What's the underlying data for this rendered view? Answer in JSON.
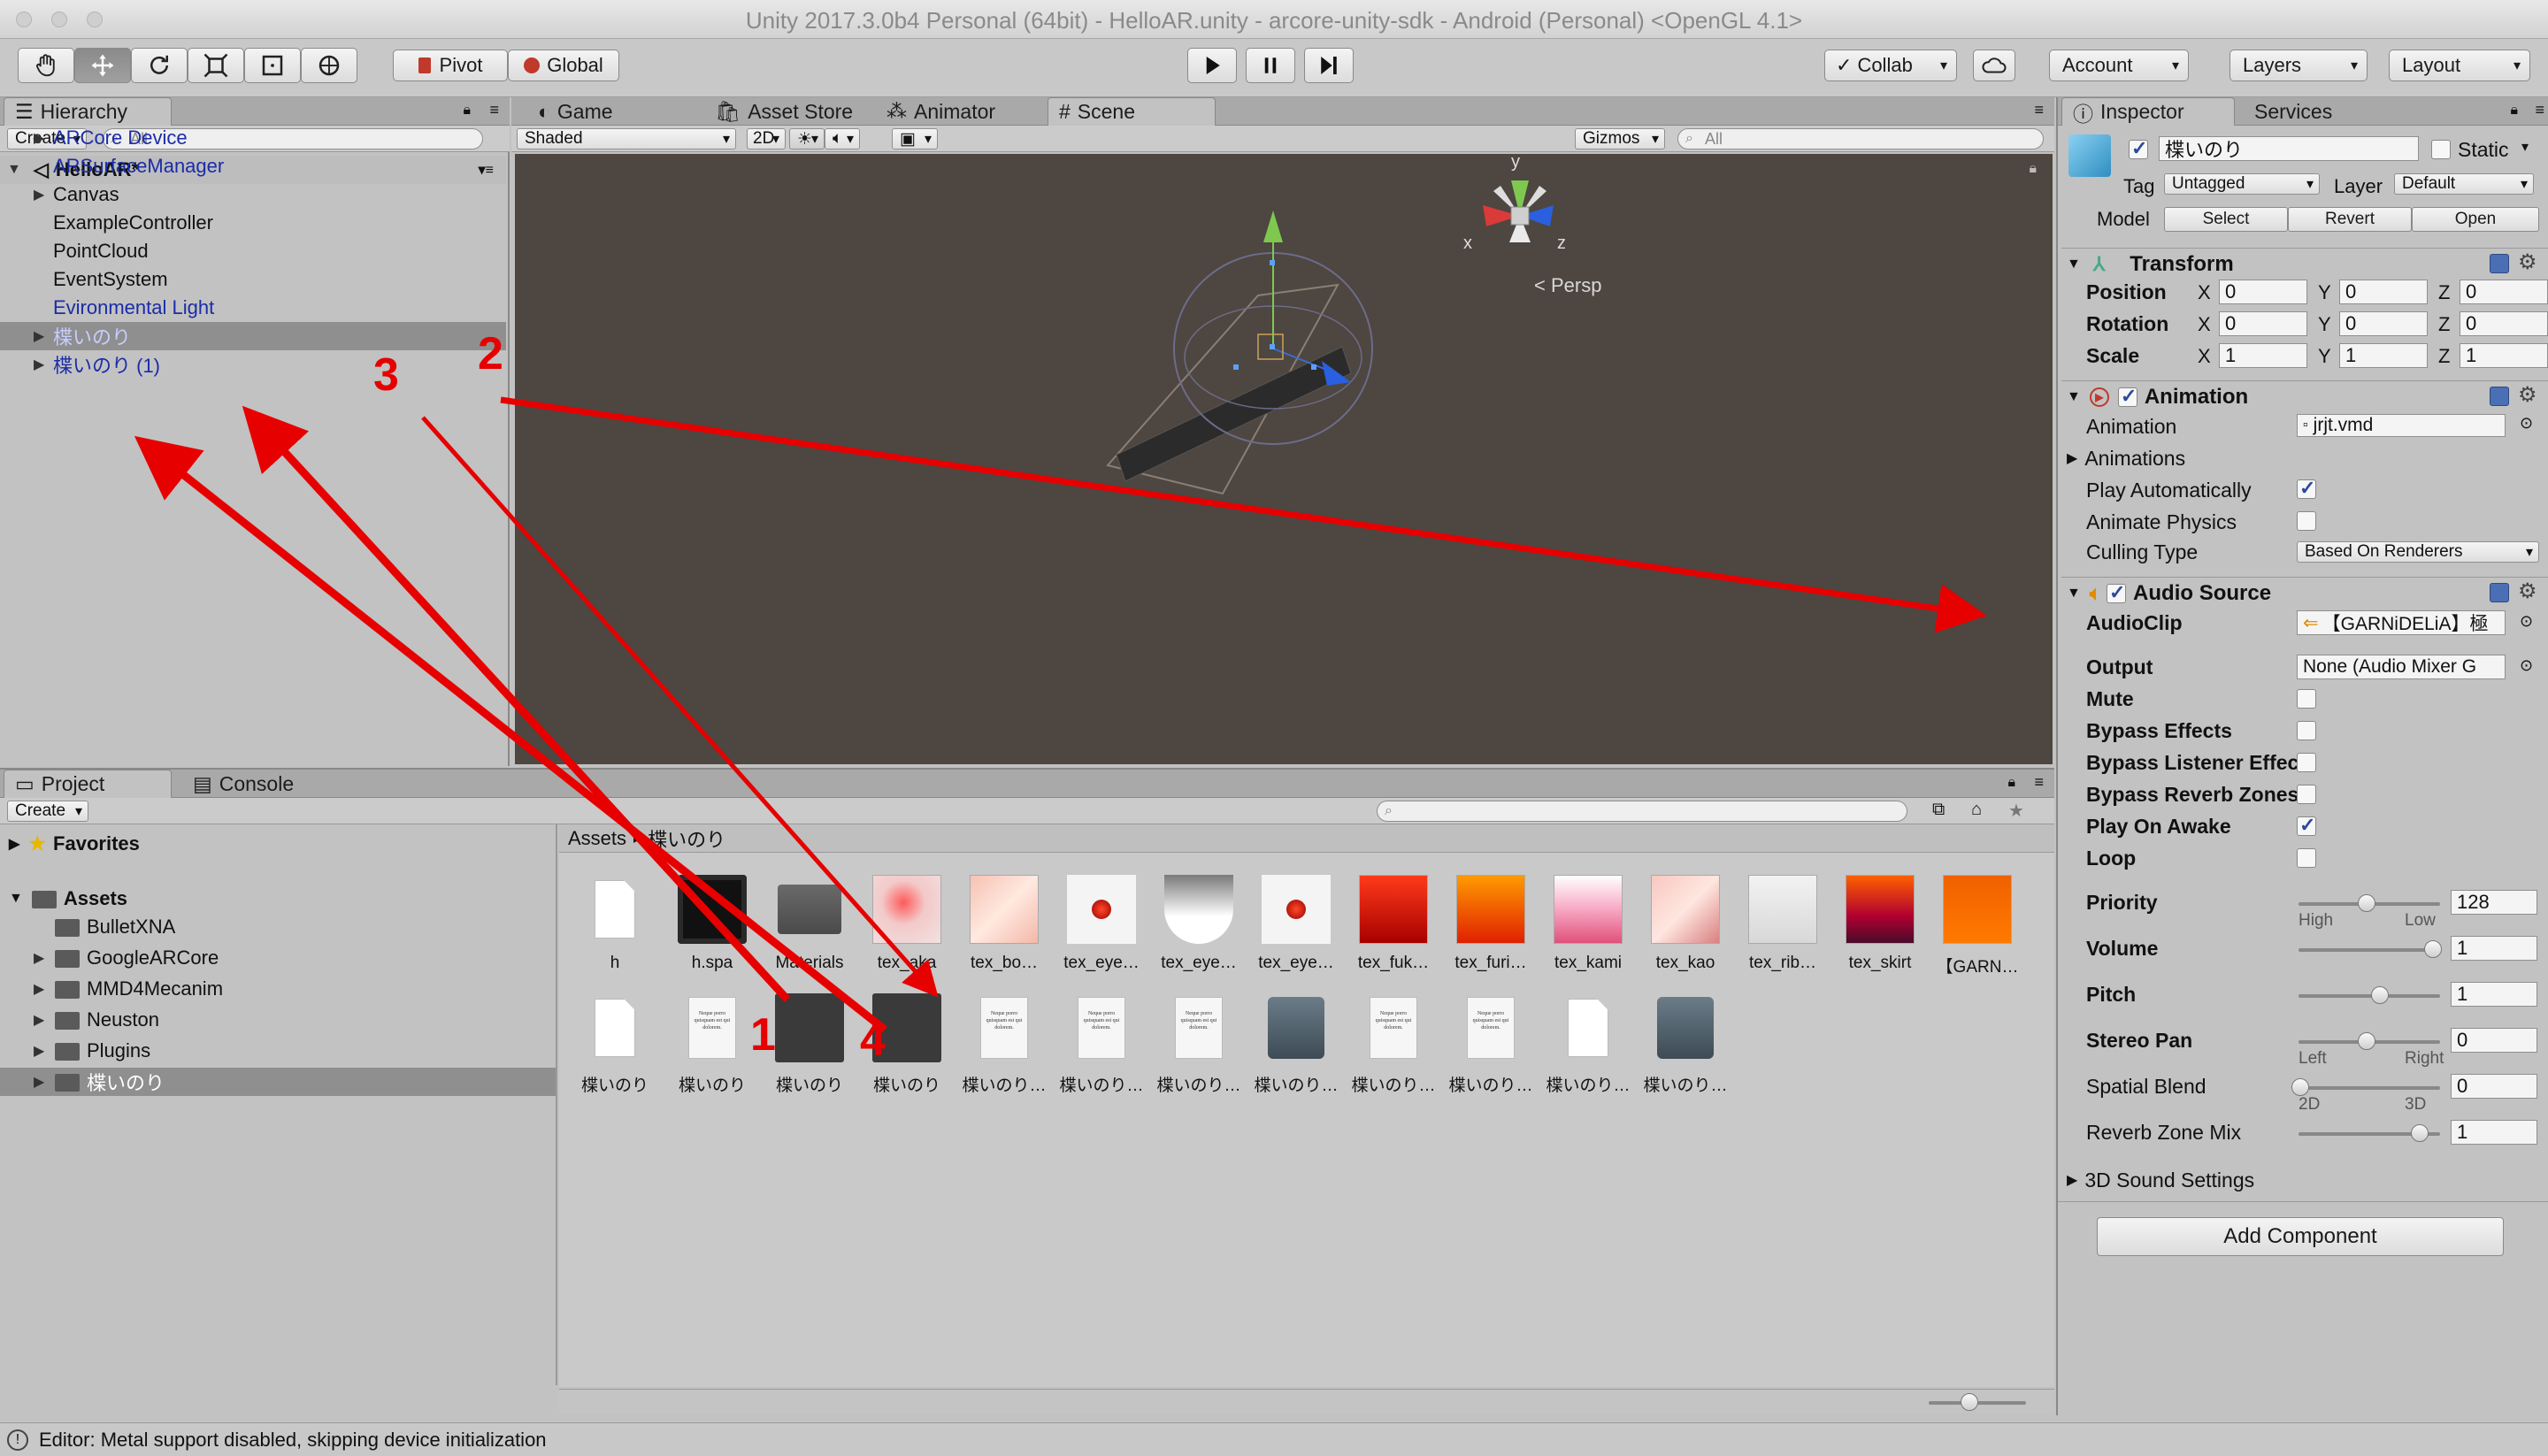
{
  "window": {
    "title": "Unity 2017.3.0b4 Personal (64bit) - HelloAR.unity - arcore-unity-sdk - Android (Personal) <OpenGL 4.1>"
  },
  "toolbar": {
    "tools": [
      "hand-tool",
      "move-tool",
      "rotate-tool",
      "scale-tool",
      "rect-tool",
      "transform-tool"
    ],
    "pivot_label": "Pivot",
    "global_label": "Global",
    "collab_label": "Collab",
    "account_label": "Account",
    "layers_label": "Layers",
    "layout_label": "Layout"
  },
  "hierarchy": {
    "tab": "Hierarchy",
    "create_label": "Create",
    "search_placeholder": "All",
    "scene_name": "HelloAR*",
    "items": [
      {
        "label": "ARCore Device",
        "expandable": true,
        "color": "blue"
      },
      {
        "label": "ARSurfaceManager",
        "expandable": false,
        "color": "blue"
      },
      {
        "label": "Canvas",
        "expandable": true,
        "color": "black"
      },
      {
        "label": "ExampleController",
        "expandable": false,
        "color": "black"
      },
      {
        "label": "PointCloud",
        "expandable": false,
        "color": "black"
      },
      {
        "label": "EventSystem",
        "expandable": false,
        "color": "black"
      },
      {
        "label": "Evironmental Light",
        "expandable": false,
        "color": "blue"
      },
      {
        "label": "楪いのり",
        "expandable": true,
        "color": "selected"
      },
      {
        "label": "楪いのり (1)",
        "expandable": true,
        "color": "blue"
      }
    ]
  },
  "scene_tabs": [
    "Game",
    "Asset Store",
    "Animator",
    "Scene"
  ],
  "scene": {
    "shading": "Shaded",
    "mode_2d": "2D",
    "gizmos_label": "Gizmos",
    "search_placeholder": "All",
    "persp_label": "Persp",
    "axis_labels": {
      "y": "y",
      "x": "x",
      "z": "z"
    }
  },
  "project": {
    "tabs": [
      "Project",
      "Console"
    ],
    "create_label": "Create",
    "favorites_label": "Favorites",
    "assets_label": "Assets",
    "folders": [
      "BulletXNA",
      "GoogleARCore",
      "MMD4Mecanim",
      "Neuston",
      "Plugins",
      "楪いのり"
    ],
    "breadcrumb_root": "Assets",
    "breadcrumb_sep": "▸",
    "breadcrumb_current": "楪いのり",
    "row1": [
      {
        "label": "h",
        "kind": "file"
      },
      {
        "label": "h.spa",
        "kind": "black-circle"
      },
      {
        "label": "Materials",
        "kind": "folder"
      },
      {
        "label": "tex_aka",
        "kind": "tex-aka"
      },
      {
        "label": "tex_bo…",
        "kind": "tex-bo"
      },
      {
        "label": "tex_eye…",
        "kind": "tex-eye1"
      },
      {
        "label": "tex_eye…",
        "kind": "tex-eye2"
      },
      {
        "label": "tex_eye…",
        "kind": "tex-eye3"
      },
      {
        "label": "tex_fuk…",
        "kind": "tex-fuk"
      },
      {
        "label": "tex_furi…",
        "kind": "tex-furi"
      },
      {
        "label": "tex_kami",
        "kind": "tex-kami"
      },
      {
        "label": "tex_kao",
        "kind": "tex-kao"
      },
      {
        "label": "tex_rib…",
        "kind": "tex-rib"
      },
      {
        "label": "tex_skirt",
        "kind": "tex-skirt"
      },
      {
        "label": "【GARN…",
        "kind": "audio"
      }
    ],
    "row2": [
      {
        "label": "楪いのり",
        "kind": "file"
      },
      {
        "label": "楪いのり",
        "kind": "text"
      },
      {
        "label": "楪いのり",
        "kind": "model"
      },
      {
        "label": "楪いのり",
        "kind": "model"
      },
      {
        "label": "楪いのり…",
        "kind": "text"
      },
      {
        "label": "楪いのり…",
        "kind": "text"
      },
      {
        "label": "楪いのり…",
        "kind": "text"
      },
      {
        "label": "楪いのり…",
        "kind": "unity"
      },
      {
        "label": "楪いのり…",
        "kind": "text"
      },
      {
        "label": "楪いのり…",
        "kind": "text"
      },
      {
        "label": "楪いのり…",
        "kind": "file"
      },
      {
        "label": "楪いのり…",
        "kind": "unity"
      }
    ],
    "text_doc_snippet": "Neque porro quisquam est qui dolorem."
  },
  "inspector": {
    "tabs": [
      "Inspector",
      "Services"
    ],
    "object_name": "楪いのり",
    "static_label": "Static",
    "tag_label": "Tag",
    "tag_value": "Untagged",
    "layer_label": "Layer",
    "layer_value": "Default",
    "model_label": "Model",
    "model_buttons": [
      "Select",
      "Revert",
      "Open"
    ],
    "transform": {
      "title": "Transform",
      "rows": [
        {
          "label": "Position",
          "x": "0",
          "y": "0",
          "z": "0"
        },
        {
          "label": "Rotation",
          "x": "0",
          "y": "0",
          "z": "0"
        },
        {
          "label": "Scale",
          "x": "1",
          "y": "1",
          "z": "1"
        }
      ],
      "axes": [
        "X",
        "Y",
        "Z"
      ]
    },
    "animation": {
      "title": "Animation",
      "animation_label": "Animation",
      "animation_value": "jrjt.vmd",
      "animations_label": "Animations",
      "play_auto_label": "Play Automatically",
      "play_auto": true,
      "animate_physics_label": "Animate Physics",
      "animate_physics": false,
      "culling_label": "Culling Type",
      "culling_value": "Based On Renderers"
    },
    "audio": {
      "title": "Audio Source",
      "clip_label": "AudioClip",
      "clip_value": "【GARNiDELiA】極",
      "output_label": "Output",
      "output_value": "None (Audio Mixer G",
      "checks": [
        {
          "label": "Mute",
          "on": false
        },
        {
          "label": "Bypass Effects",
          "on": false
        },
        {
          "label": "Bypass Listener Effec",
          "on": false
        },
        {
          "label": "Bypass Reverb Zones",
          "on": false
        },
        {
          "label": "Play On Awake",
          "on": true
        },
        {
          "label": "Loop",
          "on": false
        }
      ],
      "priority_label": "Priority",
      "priority_value": "128",
      "priority_level": 0.5,
      "priority_high": "High",
      "priority_low": "Low",
      "volume_label": "Volume",
      "volume_value": "1",
      "volume_level": 1.0,
      "pitch_label": "Pitch",
      "pitch_value": "1",
      "pitch_level": 0.6,
      "stereo_label": "Stereo Pan",
      "stereo_value": "0",
      "stereo_level": 0.5,
      "stereo_left": "Left",
      "stereo_right": "Right",
      "spatial_label": "Spatial Blend",
      "spatial_value": "0",
      "spatial_level": 0.0,
      "spatial_2d": "2D",
      "spatial_3d": "3D",
      "reverb_label": "Reverb Zone Mix",
      "reverb_value": "1",
      "reverb_level": 0.9,
      "sound3d_label": "3D Sound Settings"
    },
    "add_component": "Add Component"
  },
  "annotations": [
    "1",
    "2",
    "3",
    "4"
  ],
  "statusbar": {
    "message": "Editor: Metal support disabled, skipping device initialization"
  },
  "colors": {
    "annotation_red": "#e60000",
    "scene_bg": "#4e4640",
    "selected_row": "#8f8f8f",
    "link_blue": "#1a2ca8"
  }
}
